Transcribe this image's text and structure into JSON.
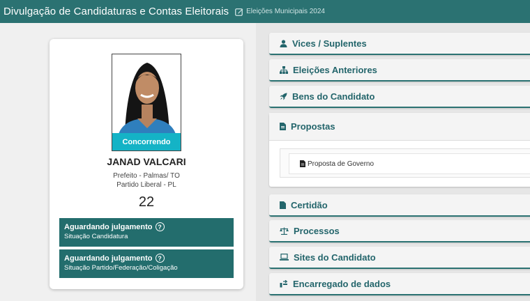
{
  "header": {
    "title": "Divulgação de Candidaturas e Contas Eleitorais",
    "election": "Eleições Municipais 2024",
    "election_icon": "edit-icon",
    "bg_color": "#2b7272"
  },
  "candidate": {
    "status_badge": "Concorrendo",
    "name": "JANAD VALCARI",
    "role": "Prefeito - Palmas/ TO",
    "party": "Partido Liberal - PL",
    "number": "22"
  },
  "status_boxes": [
    {
      "title": "Aguardando julgamento",
      "subtitle": "Situação Candidatura"
    },
    {
      "title": "Aguardando julgamento",
      "subtitle": "Situação Partido/Federação/Coligação"
    }
  ],
  "panels": {
    "vices": {
      "label": "Vices / Suplentes",
      "icon": "user-icon"
    },
    "eleicoes": {
      "label": "Eleições Anteriores",
      "icon": "sitemap-icon"
    },
    "bens": {
      "label": "Bens do Candidato",
      "icon": "rocket-icon"
    },
    "propostas": {
      "label": "Propostas",
      "icon": "file-icon",
      "document": "Proposta de Governo"
    },
    "certidao": {
      "label": "Certidão",
      "icon": "file-icon"
    },
    "processos": {
      "label": "Processos",
      "icon": "balance-scale-icon"
    },
    "sites": {
      "label": "Sites do Candidato",
      "icon": "laptop-icon"
    },
    "encarregado": {
      "label": "Encarregado de dados",
      "icon": "arrow-icon"
    }
  },
  "colors": {
    "accent": "#2b7272",
    "status_bg": "#236d6d",
    "badge": "#14b3c6",
    "panel_text": "#23656b"
  }
}
